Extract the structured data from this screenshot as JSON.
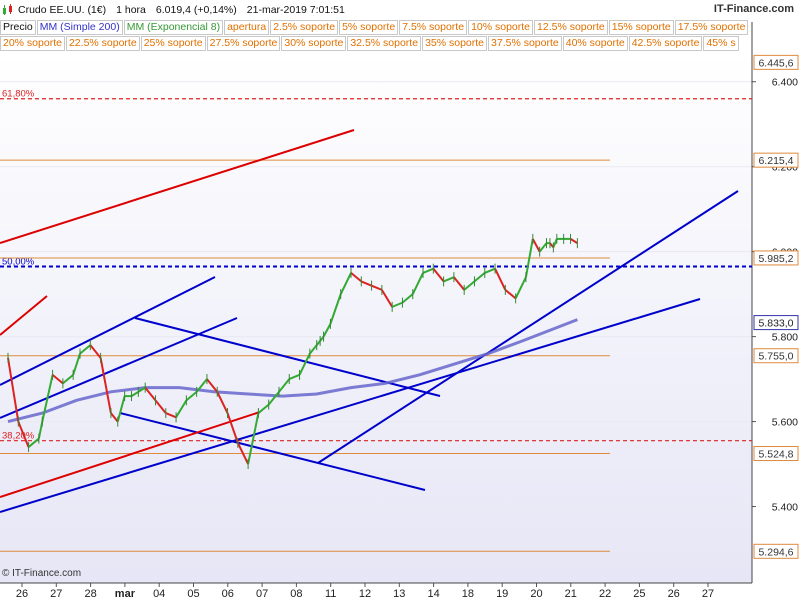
{
  "header": {
    "instrument": "Crudo EE.UU. (1€)",
    "timeframe": "1 hora",
    "last": "6.019,4 (+0,14%)",
    "datetime": "21-mar-2019 7:01:51",
    "brand": "IT-Finance.com"
  },
  "legend": {
    "price": "Precio",
    "sma": "MM (Simple 200)",
    "ema": "MM (Exponencial 8)",
    "levels_row1": [
      "apertura",
      "2.5% soporte",
      "5% soporte",
      "7.5% soporte",
      "10% soporte",
      "12.5% soporte",
      "15% soporte",
      "17.5% soporte"
    ],
    "levels_row2": [
      "20% soporte",
      "22.5% soporte",
      "25% soporte",
      "27.5% soporte",
      "30% soporte",
      "32.5% soporte",
      "35% soporte",
      "37.5% soporte",
      "40% soporte",
      "42.5% soporte",
      "45% s"
    ]
  },
  "footer": {
    "copyright": "© IT-Finance.com"
  },
  "colors": {
    "price_up": "#33aa33",
    "price_down": "#dd2222",
    "sma": "#6666cc",
    "trendline_blue": "#0000cc",
    "trendline_red": "#dd0000",
    "level_orange": "#e08a3c",
    "fib_red": "#dd2222",
    "fib_blue": "#0000cc",
    "grid": "#e9e9f4"
  },
  "chart_data": {
    "type": "line",
    "y_range": [
      5.22,
      6.47
    ],
    "y_ticks": [
      "5.400",
      "5.600",
      "5.800",
      "6.000",
      "6.200",
      "6.400"
    ],
    "x_ticks": [
      "26",
      "27",
      "28",
      "mar",
      "04",
      "05",
      "06",
      "07",
      "08",
      "11",
      "12",
      "13",
      "14",
      "18",
      "19",
      "20",
      "21",
      "22",
      "25",
      "26",
      "27"
    ],
    "horizontal_levels": [
      {
        "label": "6.445,6",
        "value": 6.4456,
        "kind": "top"
      },
      {
        "label": "6.215,4",
        "value": 6.2154,
        "kind": "orange"
      },
      {
        "label": "5.985,2",
        "value": 5.9852,
        "kind": "orange"
      },
      {
        "label": "5.833,0",
        "value": 5.833,
        "kind": "sma"
      },
      {
        "label": "5.755,0",
        "value": 5.755,
        "kind": "orange"
      },
      {
        "label": "5.524,8",
        "value": 5.5248,
        "kind": "orange"
      },
      {
        "label": "5.294,6",
        "value": 5.2946,
        "kind": "orange"
      }
    ],
    "fib_levels": [
      {
        "label": "61,80%",
        "value": 6.36,
        "color": "red"
      },
      {
        "label": "50,00%",
        "value": 5.965,
        "color": "blue"
      },
      {
        "label": "38,20%",
        "value": 5.555,
        "color": "red"
      }
    ],
    "price_series": {
      "name": "Precio",
      "x": [
        0.0,
        0.3,
        0.6,
        0.9,
        1.0,
        1.3,
        1.6,
        1.9,
        2.1,
        2.4,
        2.7,
        3.0,
        3.2,
        3.4,
        3.6,
        3.8,
        4.0,
        4.3,
        4.6,
        4.9,
        5.2,
        5.5,
        5.8,
        6.1,
        6.4,
        6.7,
        7.0,
        7.3,
        7.6,
        7.9,
        8.2,
        8.5,
        8.8,
        9.0,
        9.1,
        9.2,
        9.4,
        9.7,
        10.0,
        10.3,
        10.6,
        10.9,
        11.2,
        11.5,
        11.8,
        12.1,
        12.4,
        12.7,
        13.0,
        13.3,
        13.6,
        13.9,
        14.2,
        14.5,
        14.8,
        15.1,
        15.3,
        15.5,
        15.7,
        15.8,
        15.9,
        16.0,
        16.2,
        16.4,
        16.6
      ],
      "y": [
        5.75,
        5.6,
        5.54,
        5.56,
        5.6,
        5.71,
        5.69,
        5.71,
        5.76,
        5.78,
        5.75,
        5.62,
        5.6,
        5.66,
        5.66,
        5.67,
        5.68,
        5.65,
        5.62,
        5.61,
        5.65,
        5.67,
        5.7,
        5.67,
        5.62,
        5.55,
        5.5,
        5.62,
        5.64,
        5.67,
        5.7,
        5.71,
        5.76,
        5.78,
        5.79,
        5.8,
        5.83,
        5.9,
        5.95,
        5.93,
        5.92,
        5.91,
        5.87,
        5.88,
        5.9,
        5.95,
        5.96,
        5.93,
        5.94,
        5.91,
        5.93,
        5.95,
        5.96,
        5.91,
        5.89,
        5.94,
        6.03,
        6.0,
        6.02,
        6.02,
        6.01,
        6.03,
        6.03,
        6.03,
        6.02
      ]
    },
    "sma_series": {
      "name": "MM (Simple 200)",
      "x": [
        0,
        1,
        2,
        3,
        4,
        5,
        6,
        7,
        8,
        9,
        10,
        11,
        12,
        13,
        14,
        15,
        16.6
      ],
      "y": [
        5.6,
        5.62,
        5.65,
        5.67,
        5.68,
        5.68,
        5.67,
        5.665,
        5.66,
        5.665,
        5.68,
        5.69,
        5.71,
        5.735,
        5.76,
        5.79,
        5.84
      ]
    }
  }
}
